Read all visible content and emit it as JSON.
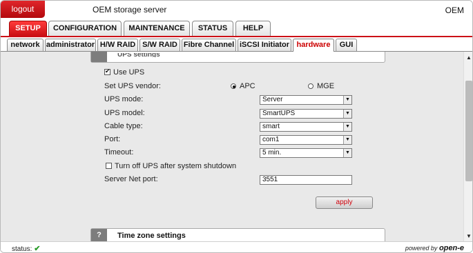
{
  "header": {
    "logout_label": "logout",
    "title": "OEM storage server",
    "brand_right": "OEM"
  },
  "main_tabs": [
    {
      "label": "SETUP",
      "active": true
    },
    {
      "label": "CONFIGURATION",
      "active": false
    },
    {
      "label": "MAINTENANCE",
      "active": false
    },
    {
      "label": "STATUS",
      "active": false
    },
    {
      "label": "HELP",
      "active": false
    }
  ],
  "sub_tabs": [
    {
      "label": "network",
      "active": false
    },
    {
      "label": "administrator",
      "active": false
    },
    {
      "label": "H/W RAID",
      "active": false
    },
    {
      "label": "S/W RAID",
      "active": false
    },
    {
      "label": "Fibre Channel",
      "active": false
    },
    {
      "label": "iSCSI Initiator",
      "active": false
    },
    {
      "label": "hardware",
      "active": true
    },
    {
      "label": "GUI",
      "active": false
    }
  ],
  "ups": {
    "section_title": "UPS settings",
    "use_ups_label": "Use UPS",
    "use_ups_checked": true,
    "vendor_label": "Set UPS vendor:",
    "vendor_options": [
      {
        "label": "APC",
        "selected": true
      },
      {
        "label": "MGE",
        "selected": false
      }
    ],
    "mode_label": "UPS mode:",
    "mode_value": "Server",
    "model_label": "UPS model:",
    "model_value": "SmartUPS",
    "cable_label": "Cable type:",
    "cable_value": "smart",
    "port_label": "Port:",
    "port_value": "com1",
    "timeout_label": "Timeout:",
    "timeout_value": "5 min.",
    "turnoff_label": "Turn off UPS after system shutdown",
    "turnoff_checked": false,
    "netport_label": "Server Net port:",
    "netport_value": "3551",
    "apply_label": "apply"
  },
  "timezone": {
    "help_glyph": "?",
    "title": "Time zone settings"
  },
  "statusbar": {
    "status_label": "status:",
    "status_icon": "check-icon",
    "powered_by": "powered by",
    "brand": "open-e"
  },
  "colors": {
    "accent": "#cc1017",
    "status_ok": "#2a9c2a"
  }
}
